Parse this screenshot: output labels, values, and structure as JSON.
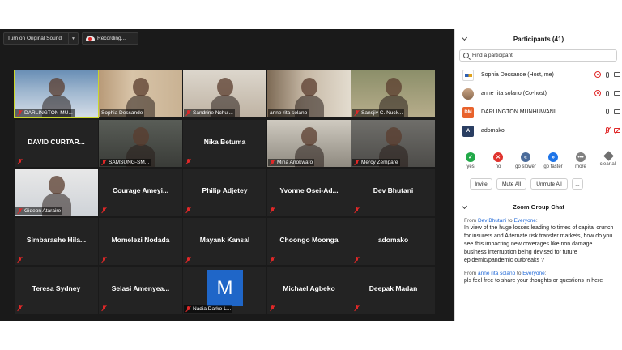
{
  "topbar": {
    "original_sound": "Turn on Original Sound",
    "recording": "Recording..."
  },
  "tiles": [
    {
      "name": "DARLINGTON MU...",
      "video": "v-darlington",
      "active": true
    },
    {
      "name": "Sophia Dessande",
      "video": "v-sophia",
      "muted": false
    },
    {
      "name": "Sandrine Nchui...",
      "video": "v-sandrine"
    },
    {
      "name": "anne rita solano",
      "video": "v-anne",
      "muted": false
    },
    {
      "name": "Sansjiv C. Nuck...",
      "video": "v-sanjiv"
    },
    {
      "big": "DAVID CURTAR..."
    },
    {
      "name": "SAMSUNG-SM...",
      "video": "v-samsung"
    },
    {
      "big": "Nika Betuma"
    },
    {
      "name": "Mina Anokwafo",
      "video": "v-mina"
    },
    {
      "name": "Mercy Zempare",
      "video": "v-mercy"
    },
    {
      "name": "Gideon Ataraire",
      "video": "v-gideon"
    },
    {
      "big": "Courage  Ameyi..."
    },
    {
      "big": "Philip Adjetey"
    },
    {
      "big": "Yvonne  Osei-Ad..."
    },
    {
      "big": "Dev Bhutani"
    },
    {
      "big": "Simbarashe  Hila..."
    },
    {
      "big": "Momelezi Nodada"
    },
    {
      "big": "Mayank Kansal"
    },
    {
      "big": "Choongo Moonga"
    },
    {
      "big": "adomako"
    },
    {
      "big": "Teresa Sydney"
    },
    {
      "big": "Selasi  Amenyea..."
    },
    {
      "name": "Nadia Darko-L...",
      "avatar": "M"
    },
    {
      "big": "Michael Agbeko"
    },
    {
      "big": "Deepak Madan"
    }
  ],
  "participants": {
    "title": "Participants (41)",
    "search_placeholder": "Find a participant",
    "list": [
      {
        "name": "Sophia Dessande (Host, me)",
        "avatar": "logo"
      },
      {
        "name": "anne rita solano (Co-host)",
        "avatar": "photo"
      },
      {
        "name": "DARLINGTON MUNHUWANI",
        "avatar": "dm",
        "initials": "DM"
      },
      {
        "name": "adomako",
        "avatar": "a",
        "initials": "A"
      }
    ],
    "reactions": [
      {
        "label": "yes",
        "icon": "check-icon",
        "glyph": "✓",
        "cls": "b-yes"
      },
      {
        "label": "no",
        "icon": "x-icon",
        "glyph": "✕",
        "cls": "b-no"
      },
      {
        "label": "go slower",
        "icon": "slower-icon",
        "glyph": "«",
        "cls": "b-slow"
      },
      {
        "label": "go faster",
        "icon": "faster-icon",
        "glyph": "»",
        "cls": "b-fast"
      },
      {
        "label": "more",
        "icon": "more-icon",
        "glyph": "•••",
        "cls": "b-more"
      },
      {
        "label": "clear all",
        "icon": "clear-icon",
        "glyph": "",
        "cls": "b-clear"
      }
    ],
    "buttons": {
      "invite": "Invite",
      "mute_all": "Mute All",
      "unmute_all": "Unmute All",
      "more": "..."
    }
  },
  "chat": {
    "title": "Zoom Group Chat",
    "messages": [
      {
        "from_prefix": "From ",
        "sender": "Dev Bhutani",
        "to_text": " to ",
        "recipient": "Everyone",
        "colon": ":",
        "text": "In view of the huge losses leading to times of capital crunch for insurers and Alternate risk transfer markets, how do you see this impacting new coverages like non damage business interruption being devised for future epidemic/pandemic outbreaks ?"
      },
      {
        "from_prefix": "From ",
        "sender": "anne rita solano",
        "to_text": " to ",
        "recipient": "Everyone",
        "colon": ":",
        "text": "pls feel free to share your thoughts or questions in here"
      }
    ]
  },
  "colors": {
    "active_speaker": "#c9d62a",
    "mute_red": "#e02828",
    "link_blue": "#1d66d6",
    "avatar_blue": "#1f66c8"
  }
}
